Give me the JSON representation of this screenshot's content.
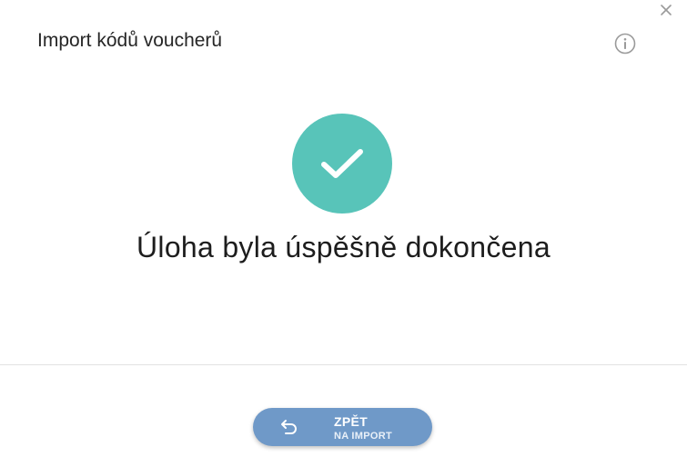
{
  "dialog": {
    "title": "Import kódů voucherů",
    "message": "Úloha byla úspěšně dokončena"
  },
  "icons": {
    "close": "close-icon",
    "info": "info-icon",
    "success": "checkmark-icon",
    "back": "undo-arrow-icon"
  },
  "footer": {
    "back_button": {
      "label": "ZPĚT",
      "sublabel": "NA IMPORT"
    }
  },
  "colors": {
    "success": "#58c4b9",
    "button": "#6f99c8",
    "icon_gray": "#9a9a9a"
  }
}
